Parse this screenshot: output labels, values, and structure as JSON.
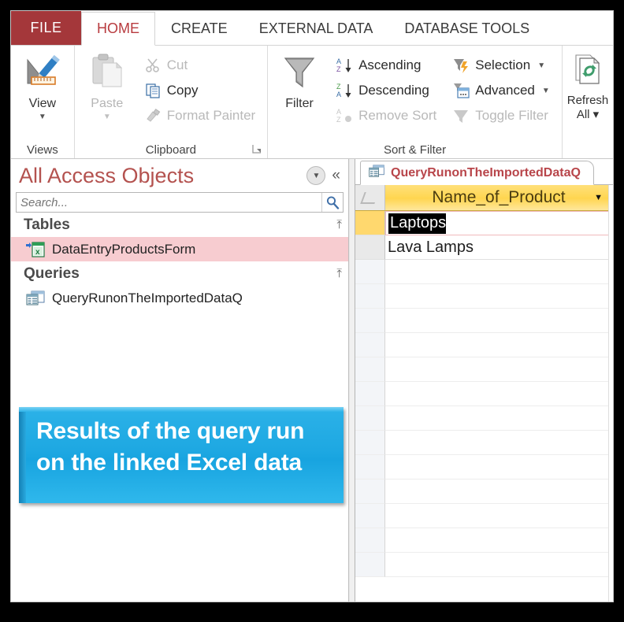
{
  "window": {
    "app": "Microsoft Access 2013"
  },
  "ribbon": {
    "tabs": [
      {
        "label": "FILE",
        "active": false,
        "kind": "file"
      },
      {
        "label": "HOME",
        "active": true,
        "kind": "normal"
      },
      {
        "label": "CREATE",
        "active": false,
        "kind": "normal"
      },
      {
        "label": "EXTERNAL DATA",
        "active": false,
        "kind": "normal"
      },
      {
        "label": "DATABASE TOOLS",
        "active": false,
        "kind": "normal"
      }
    ],
    "groups": {
      "views": {
        "label": "Views",
        "view_button": "View",
        "view_icon": "view-design-icon"
      },
      "clipboard": {
        "label": "Clipboard",
        "paste_button": "Paste",
        "cut_label": "Cut",
        "copy_label": "Copy",
        "format_painter_label": "Format Painter",
        "launcher_icon": "dialog-launcher-icon"
      },
      "sortfilter": {
        "label": "Sort & Filter",
        "filter_button": "Filter",
        "ascending_label": "Ascending",
        "descending_label": "Descending",
        "remove_sort_label": "Remove Sort",
        "selection_label": "Selection",
        "advanced_label": "Advanced",
        "toggle_filter_label": "Toggle Filter"
      },
      "records": {
        "refresh_line1": "Refresh",
        "refresh_line2": "All"
      }
    }
  },
  "nav": {
    "title": "All Access Objects",
    "dropdown_icon": "chevron-down-circle-icon",
    "collapse_icon": "double-chevron-left-icon",
    "search": {
      "placeholder": "Search...",
      "value": "",
      "icon": "search-icon"
    },
    "sections": [
      {
        "label": "Tables",
        "collapse_icon": "double-chevron-up-icon",
        "items": [
          {
            "label": "DataEntryProductsForm",
            "icon": "linked-excel-table-icon",
            "selected": true
          }
        ]
      },
      {
        "label": "Queries",
        "collapse_icon": "double-chevron-up-icon",
        "items": [
          {
            "label": "QueryRunonTheImportedDataQ",
            "icon": "query-icon",
            "selected": false
          }
        ]
      }
    ]
  },
  "callout": {
    "text": "Results of the query run on the linked Excel data",
    "background_color": "#1ea8e2",
    "text_color": "#ffffff"
  },
  "datasheet": {
    "tab": {
      "label": "QueryRunonTheImportedDataQ",
      "icon": "query-icon"
    },
    "columns": [
      {
        "name": "Name_of_Product",
        "dropdown_icon": "filter-dropdown-icon"
      }
    ],
    "rows": [
      {
        "Name_of_Product": "Laptops",
        "current": true,
        "text_selected": true
      },
      {
        "Name_of_Product": "Lava Lamps",
        "current": false,
        "text_selected": false
      }
    ],
    "empty_row_count": 13,
    "header_color": "#ffd754",
    "current_row_marker_color": "#ffd86e"
  }
}
